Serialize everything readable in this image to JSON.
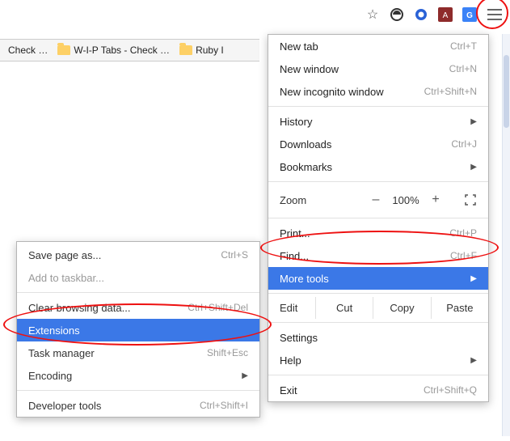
{
  "toolbar": {
    "star": "☆",
    "hamburger_title": "Customize and control Google Chrome"
  },
  "bookmarks": {
    "items": [
      {
        "label": "Check …"
      },
      {
        "label": "W-I-P Tabs - Check …"
      },
      {
        "label": "Ruby I"
      }
    ]
  },
  "menu": {
    "new_tab": {
      "label": "New tab",
      "shortcut": "Ctrl+T"
    },
    "new_window": {
      "label": "New window",
      "shortcut": "Ctrl+N"
    },
    "incognito": {
      "label": "New incognito window",
      "shortcut": "Ctrl+Shift+N"
    },
    "history": {
      "label": "History"
    },
    "downloads": {
      "label": "Downloads",
      "shortcut": "Ctrl+J"
    },
    "bookmarks": {
      "label": "Bookmarks"
    },
    "zoom": {
      "label": "Zoom",
      "minus": "–",
      "value": "100%",
      "plus": "+"
    },
    "print": {
      "label": "Print...",
      "shortcut": "Ctrl+P"
    },
    "find": {
      "label": "Find...",
      "shortcut": "Ctrl+F"
    },
    "more_tools": {
      "label": "More tools"
    },
    "edit": {
      "label": "Edit",
      "cut": "Cut",
      "copy": "Copy",
      "paste": "Paste"
    },
    "settings": {
      "label": "Settings"
    },
    "help": {
      "label": "Help"
    },
    "exit": {
      "label": "Exit",
      "shortcut": "Ctrl+Shift+Q"
    }
  },
  "submenu": {
    "save_page": {
      "label": "Save page as...",
      "shortcut": "Ctrl+S"
    },
    "add_taskbar": {
      "label": "Add to taskbar..."
    },
    "clear_data": {
      "label": "Clear browsing data...",
      "shortcut": "Ctrl+Shift+Del"
    },
    "extensions": {
      "label": "Extensions"
    },
    "task_manager": {
      "label": "Task manager",
      "shortcut": "Shift+Esc"
    },
    "encoding": {
      "label": "Encoding"
    },
    "dev_tools": {
      "label": "Developer tools",
      "shortcut": "Ctrl+Shift+I"
    }
  }
}
